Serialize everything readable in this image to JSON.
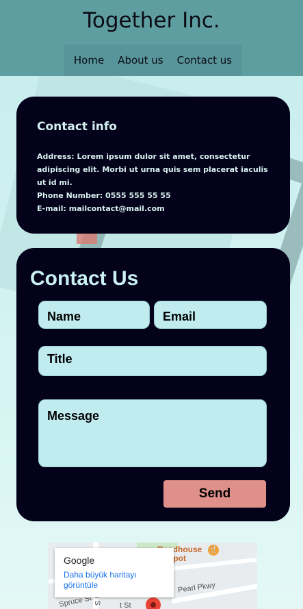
{
  "header": {
    "brand": "Together Inc.",
    "nav": [
      "Home",
      "About us",
      "Contact us"
    ]
  },
  "contact_info": {
    "title": "Contact info",
    "address": "Address: Lorem ipsum dulor sit amet, consectetur adipiscing elit. Morbi ut urna quis sem placerat iaculis ut id mi.",
    "phone": "Phone Number: 0555 555 55 55",
    "email": "E-mail: mailcontact@mail.com"
  },
  "form": {
    "title": "Contact Us",
    "name_placeholder": "Name",
    "email_placeholder": "Email",
    "title_placeholder": "Title",
    "message_placeholder": "Message",
    "send_label": "Send"
  },
  "map": {
    "provider": "Google",
    "link": "Daha büyük haritayı görüntüle",
    "poi": "Roadhouse Depot",
    "poi_line1": "Roadhouse",
    "poi_line2": "r Depot",
    "street1": "Pearl Pkwy",
    "street2": "Spruce St",
    "street3": "th S",
    "street4": "t St"
  },
  "colors": {
    "header_bg": "#5f9ea0",
    "card_bg": "#03021a",
    "field_bg": "#c0ecef",
    "send_bg": "#df908a"
  }
}
